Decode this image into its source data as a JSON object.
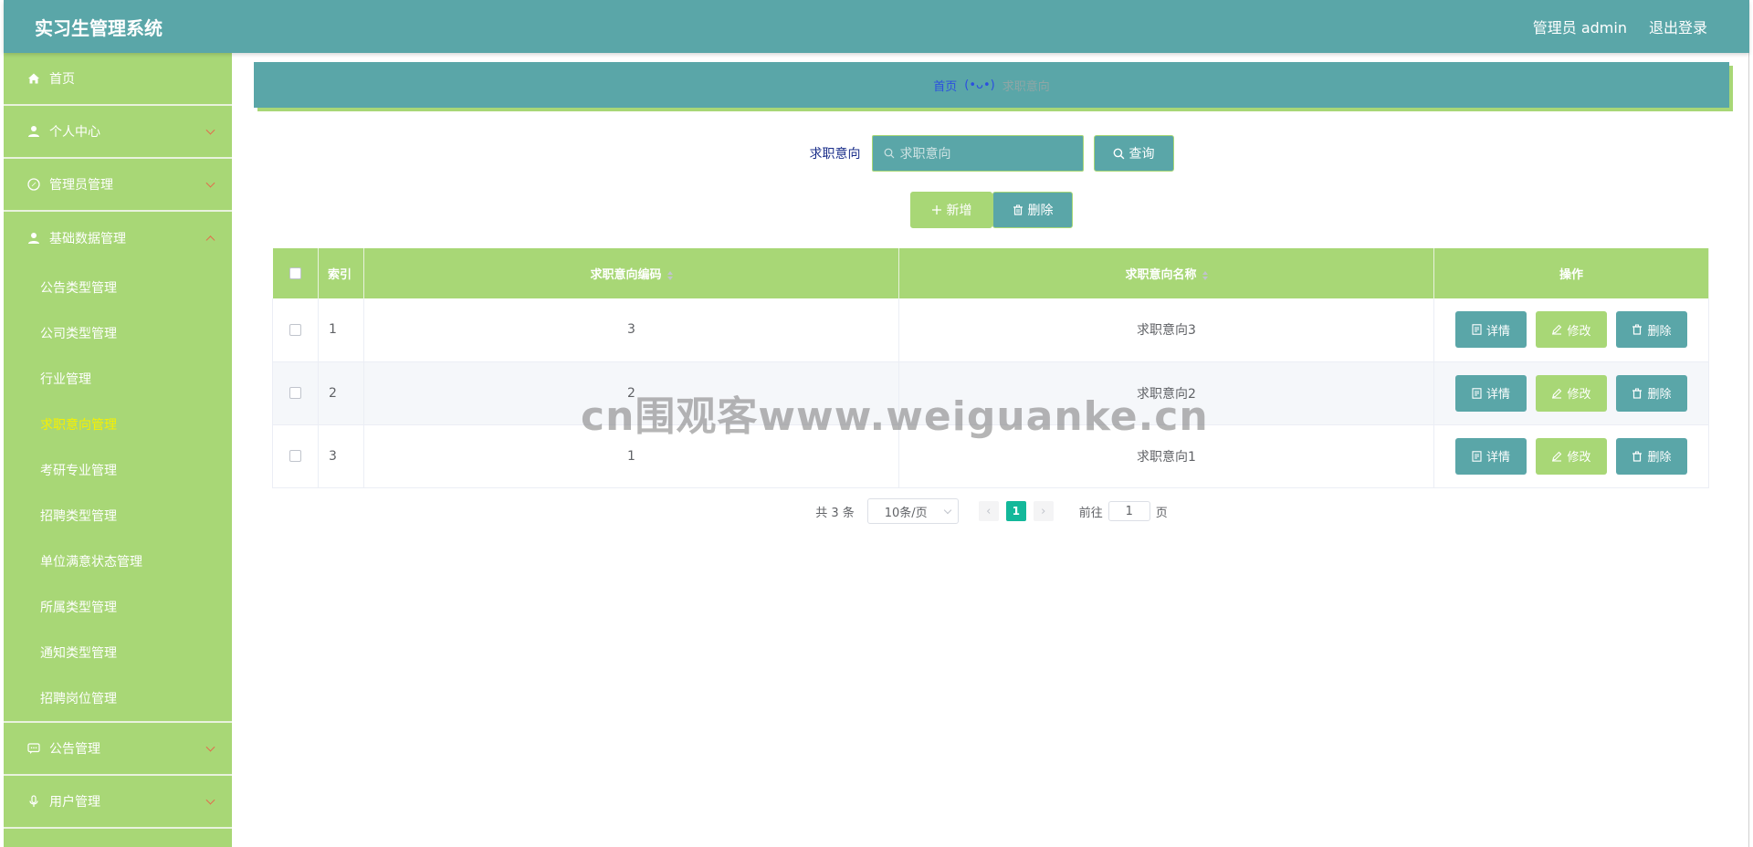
{
  "header": {
    "title": "实习生管理系统",
    "user": "管理员 admin",
    "logout": "退出登录"
  },
  "sidebar": {
    "items": [
      {
        "label": "首页",
        "icon": "home-icon"
      },
      {
        "label": "个人中心",
        "icon": "user-icon"
      },
      {
        "label": "管理员管理",
        "icon": "compass-icon"
      },
      {
        "label": "基础数据管理",
        "icon": "user-icon"
      }
    ],
    "sub_items": [
      "公告类型管理",
      "公司类型管理",
      "行业管理",
      "求职意向管理",
      "考研专业管理",
      "招聘类型管理",
      "单位满意状态管理",
      "所属类型管理",
      "通知类型管理",
      "招聘岗位管理"
    ],
    "bottom_items": [
      {
        "label": "公告管理",
        "icon": "chat-icon"
      },
      {
        "label": "用户管理",
        "icon": "mic-icon"
      }
    ],
    "active_sub": "求职意向管理"
  },
  "breadcrumb": {
    "home": "首页",
    "separator": "(•ᴗ•)",
    "current": "求职意向"
  },
  "search": {
    "label": "求职意向",
    "placeholder": "求职意向",
    "query_button": "查询"
  },
  "actions": {
    "add": "新增",
    "delete": "删除"
  },
  "table": {
    "headers": [
      "索引",
      "求职意向编码",
      "求职意向名称",
      "操作"
    ],
    "rows": [
      {
        "index": "1",
        "code": "3",
        "name": "求职意向3"
      },
      {
        "index": "2",
        "code": "2",
        "name": "求职意向2"
      },
      {
        "index": "3",
        "code": "1",
        "name": "求职意向1"
      }
    ],
    "row_actions": {
      "detail": "详情",
      "edit": "修改",
      "remove": "删除"
    }
  },
  "pagination": {
    "total": "共 3 条",
    "page_size": "10条/页",
    "current_page": "1",
    "goto_label": "前往",
    "goto_value": "1",
    "page_suffix": "页"
  },
  "watermark": "cn围观客www.weiguanke.cn",
  "colors": {
    "teal": "#5aa6a8",
    "green": "#a8d776",
    "active_sub": "#f6f000",
    "page_active": "#13b89a"
  }
}
